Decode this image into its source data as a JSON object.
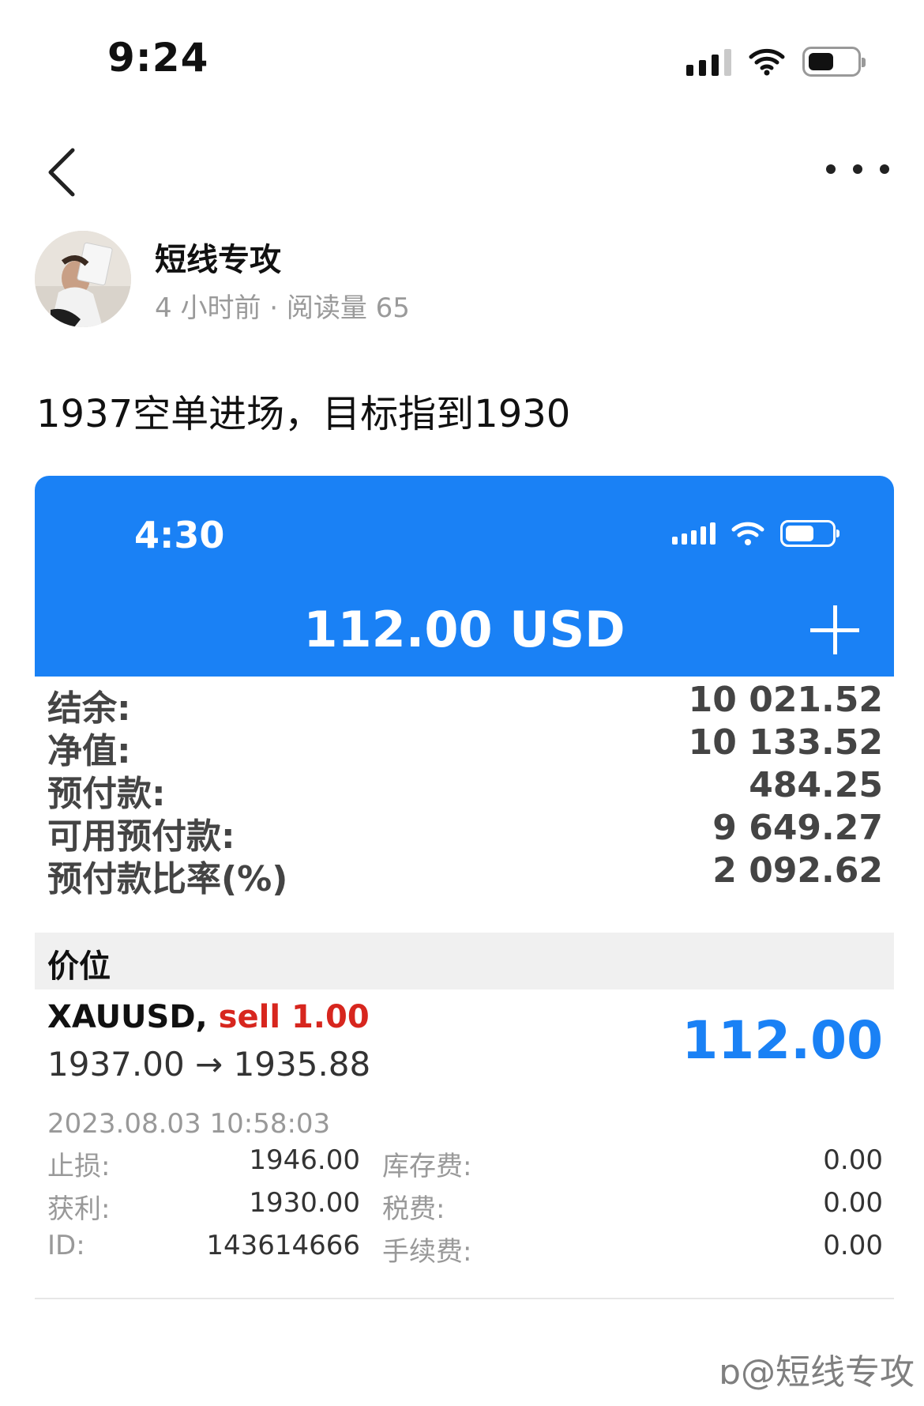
{
  "status_bar": {
    "time": "9:24"
  },
  "post": {
    "author": "短线专攻",
    "meta": "4 小时前 · 阅读量 65",
    "text": "1937空单进场，目标指到1930"
  },
  "embedded": {
    "time": "4:30",
    "balance_title": "112.00 USD",
    "account": [
      {
        "label": "结余:",
        "value": "10 021.52"
      },
      {
        "label": "净值:",
        "value": "10 133.52"
      },
      {
        "label": "预付款:",
        "value": "484.25"
      },
      {
        "label": "可用预付款:",
        "value": "9 649.27"
      },
      {
        "label": "预付款比率(%)",
        "value": "2 092.62"
      }
    ],
    "section_title": "价位",
    "position": {
      "symbol": "XAUUSD,",
      "side": "sell 1.00",
      "prices": "1937.00 → 1935.88",
      "profit": "112.00",
      "time": "2023.08.03 10:58:03",
      "details": [
        {
          "label": "止损:",
          "value": "1946.00",
          "label2": "库存费:",
          "value2": "0.00"
        },
        {
          "label": "获利:",
          "value": "1930.00",
          "label2": "税费:",
          "value2": "0.00"
        },
        {
          "label": "ID:",
          "value": "143614666",
          "label2": "手续费:",
          "value2": "0.00"
        }
      ]
    }
  },
  "watermark": "@短线专攻",
  "colors": {
    "accent": "#1a81f5",
    "sell": "#d7261e"
  }
}
